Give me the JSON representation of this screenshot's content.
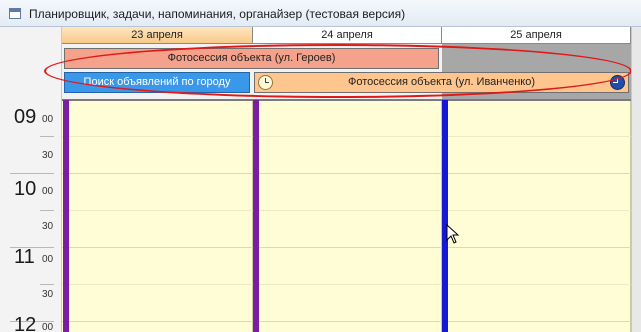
{
  "window": {
    "title": "Планировщик, задачи, напоминания, органайзер (тестовая версия)"
  },
  "days": [
    {
      "label": "23 апреля"
    },
    {
      "label": "24 апреля"
    },
    {
      "label": "25 апреля"
    }
  ],
  "allday_events": [
    {
      "title": "Фотосессия объекта (ул. Героев)"
    },
    {
      "title": "Поиск объявлений по городу"
    },
    {
      "title": "Фотосессия объекта (ул. Иванченко)"
    }
  ],
  "time_scale": [
    {
      "hour": "09",
      "min": "00",
      "half": "30"
    },
    {
      "hour": "10",
      "min": "00",
      "half": "30"
    },
    {
      "hour": "11",
      "min": "00",
      "half": "30"
    },
    {
      "hour": "12",
      "min": "00"
    }
  ],
  "colors": {
    "highlight_ellipse": "#e01818",
    "today_header": "#f7c98a",
    "grid_background": "#fffdd6",
    "day1_bar": "#7a1fa0",
    "day2_bar": "#7a1fa0",
    "day3_bar": "#1717d6"
  }
}
